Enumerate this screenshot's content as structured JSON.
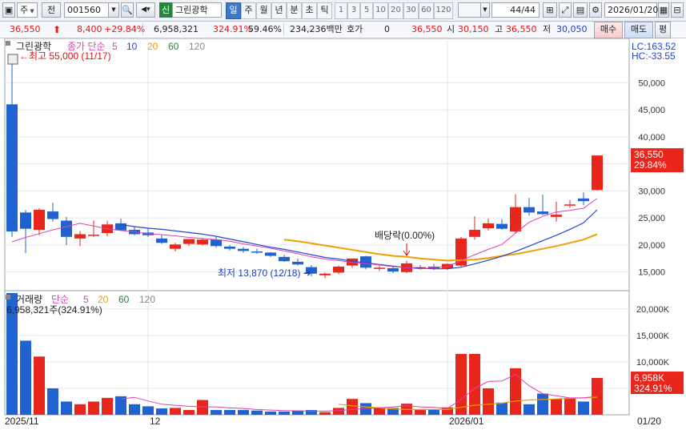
{
  "toolbar": {
    "market": "주",
    "jeon": "전",
    "code": "001560",
    "shin": "신",
    "name": "그린광학",
    "periods": [
      "일",
      "주",
      "월",
      "년",
      "분",
      "초",
      "틱"
    ],
    "active_period": "일",
    "nums": [
      "1",
      "3",
      "5",
      "10",
      "20",
      "30",
      "60",
      "120"
    ],
    "count": "44",
    "count_total": "/44",
    "date": "2026/01/20"
  },
  "info": {
    "price": "36,550",
    "change": "8,400",
    "change_pct": "+29.84%",
    "volume": "6,958,321",
    "vol_ratio": "324.91%",
    "turnover": "59.46%",
    "amount": "234,236백만",
    "hoga_label": "호가",
    "hoga_val": "0",
    "hoga_price": "36,550",
    "open_label": "시",
    "open": "30,150",
    "high_label": "고",
    "high": "36,550",
    "low_label": "저",
    "low": "30,050",
    "buy": "매수",
    "sell": "매도",
    "pyeong": "평"
  },
  "price_panel": {
    "title": "그린광학",
    "ma_label": "종가 단순",
    "ma_periods": [
      "5",
      "10",
      "20",
      "60",
      "120"
    ],
    "lc": "LC:163.52",
    "hc": "HC:-33.55",
    "high_note": "최고 55,000 (11/17)",
    "low_note": "최저 13,870 (12/18)",
    "event_note": "배당락(0.00%)",
    "current_price": "36,550",
    "current_pct": "29.84%"
  },
  "volume_panel": {
    "title": "거래량",
    "ma_label": "단순",
    "ma_periods": [
      "5",
      "20",
      "60",
      "120"
    ],
    "current_note": "6,958,321주(324.91%)",
    "current_vol": "6,958K",
    "current_pct": "324.91%"
  },
  "x_labels": [
    "2025/11",
    "12",
    "2026/01",
    "01/20"
  ],
  "colors": {
    "up": "#e8261c",
    "down": "#1f62d0",
    "ma5": "#e040b0",
    "ma10": "#2244dd",
    "ma20": "#f0a000",
    "bg": "#ffffff",
    "grid": "#e4e8ee"
  },
  "chart_data": {
    "type": "candlestick",
    "price_axis": {
      "ylim": [
        12000,
        57000
      ],
      "ticks": [
        15000,
        20000,
        25000,
        30000,
        35000,
        40000,
        45000,
        50000
      ]
    },
    "volume_axis": {
      "ylim": [
        0,
        23000
      ],
      "ticks": [
        5000,
        10000,
        15000,
        20000
      ],
      "unit": "K"
    },
    "candles": [
      [
        46000,
        55000,
        21500,
        22500,
        23000
      ],
      [
        26000,
        26500,
        18500,
        23000,
        14000
      ],
      [
        22800,
        26800,
        21800,
        26500,
        11000
      ],
      [
        26200,
        27800,
        24300,
        24800,
        5000
      ],
      [
        24500,
        25200,
        20000,
        21500,
        2500
      ],
      [
        21200,
        22600,
        19800,
        22000,
        2000
      ],
      [
        21800,
        24500,
        21500,
        21900,
        2500
      ],
      [
        22200,
        24500,
        21600,
        23800,
        3200
      ],
      [
        24000,
        24900,
        22600,
        22700,
        3500
      ],
      [
        22800,
        23300,
        21800,
        22000,
        2000
      ],
      [
        22300,
        23200,
        21500,
        21800,
        1600
      ],
      [
        21200,
        21900,
        20200,
        20400,
        1200
      ],
      [
        19300,
        20400,
        18800,
        20100,
        1300
      ],
      [
        20200,
        21000,
        19800,
        21100,
        900
      ],
      [
        20100,
        21200,
        19900,
        21000,
        2800
      ],
      [
        21000,
        21500,
        19500,
        19800,
        900
      ],
      [
        19700,
        20000,
        19000,
        19300,
        900
      ],
      [
        19300,
        19600,
        18600,
        18900,
        900
      ],
      [
        18800,
        19300,
        18400,
        18600,
        800
      ],
      [
        18600,
        18700,
        17800,
        18000,
        600
      ],
      [
        17800,
        18200,
        16900,
        17000,
        600
      ],
      [
        16900,
        17500,
        16200,
        16400,
        800
      ],
      [
        15900,
        16300,
        14200,
        14700,
        900
      ],
      [
        14400,
        14900,
        13870,
        14700,
        500
      ],
      [
        14900,
        16200,
        14600,
        16000,
        1300
      ],
      [
        16200,
        17500,
        15800,
        17500,
        3000
      ],
      [
        17900,
        18000,
        15500,
        15800,
        2200
      ],
      [
        15700,
        16100,
        15200,
        15800,
        1400
      ],
      [
        15700,
        16100,
        14800,
        15100,
        1300
      ],
      [
        15000,
        17100,
        14800,
        16600,
        2100
      ],
      [
        15800,
        16300,
        15500,
        15900,
        900
      ],
      [
        16000,
        16500,
        15400,
        15700,
        1000
      ],
      [
        15700,
        16600,
        15400,
        16500,
        1400
      ],
      [
        16200,
        21500,
        16000,
        21200,
        11500
      ],
      [
        21500,
        25300,
        21000,
        22800,
        11500
      ],
      [
        23100,
        24900,
        22700,
        24000,
        5000
      ],
      [
        23900,
        24800,
        22800,
        23000,
        2300
      ],
      [
        22500,
        29400,
        22200,
        27000,
        8800
      ],
      [
        27000,
        28700,
        25400,
        26000,
        2000
      ],
      [
        26200,
        29300,
        25500,
        25700,
        4000
      ],
      [
        25200,
        28000,
        24300,
        25600,
        3000
      ],
      [
        27300,
        28300,
        26900,
        27500,
        3200
      ],
      [
        28600,
        29700,
        27400,
        28100,
        2500
      ],
      [
        30150,
        36550,
        30050,
        36550,
        6958
      ]
    ],
    "ma5": [
      20600,
      21400,
      22100,
      22800,
      23400,
      24000,
      23500,
      23000,
      22700,
      22400,
      22100,
      21900,
      21700,
      21400,
      21200,
      21000,
      20700,
      20200,
      19800,
      19400,
      18900,
      18400,
      17800,
      17400,
      17100,
      16800,
      16600,
      16300,
      16000,
      15800,
      15600,
      15800,
      16000,
      17100,
      18200,
      19200,
      20100,
      22200,
      24200,
      25300,
      26100,
      26400,
      26800,
      28600
    ],
    "ma10": [
      null,
      null,
      null,
      null,
      null,
      null,
      null,
      null,
      23800,
      23400,
      23100,
      22900,
      22600,
      22300,
      22000,
      21600,
      21100,
      20600,
      20100,
      19600,
      19200,
      18700,
      18200,
      17700,
      17400,
      17000,
      16700,
      16400,
      16100,
      15800,
      15700,
      15600,
      15600,
      15900,
      16500,
      17200,
      17900,
      18800,
      19800,
      20800,
      21800,
      22900,
      24100,
      26500
    ],
    "ma20": [
      null,
      null,
      null,
      null,
      null,
      null,
      null,
      null,
      null,
      null,
      null,
      null,
      null,
      null,
      null,
      null,
      null,
      null,
      null,
      null,
      21000,
      20700,
      20300,
      19900,
      19500,
      19100,
      18700,
      18300,
      18000,
      17800,
      17500,
      17300,
      17100,
      17200,
      17300,
      17600,
      18000,
      18300,
      18800,
      19300,
      19800,
      20400,
      21000,
      22000
    ],
    "vol_ma5": [
      null,
      null,
      null,
      null,
      null,
      null,
      null,
      null,
      3000,
      3300,
      2600,
      2000,
      1800,
      1600,
      1500,
      1500,
      1300,
      1200,
      1000,
      900,
      800,
      750,
      700,
      700,
      800,
      1000,
      1200,
      1300,
      1500,
      1700,
      1500,
      1400,
      1200,
      2900,
      5000,
      6300,
      6400,
      7600,
      5500,
      4000,
      3600,
      3200,
      3200,
      3500
    ],
    "vol_ma20": [
      null,
      null,
      null,
      null,
      null,
      null,
      null,
      null,
      null,
      null,
      null,
      null,
      null,
      null,
      null,
      null,
      null,
      null,
      null,
      null,
      null,
      null,
      null,
      null,
      2000,
      1700,
      1500,
      1300,
      1100,
      1000,
      1000,
      1000,
      1000,
      1400,
      1800,
      2000,
      2200,
      2600,
      2800,
      2900,
      3000,
      3100,
      3200,
      3300
    ]
  }
}
